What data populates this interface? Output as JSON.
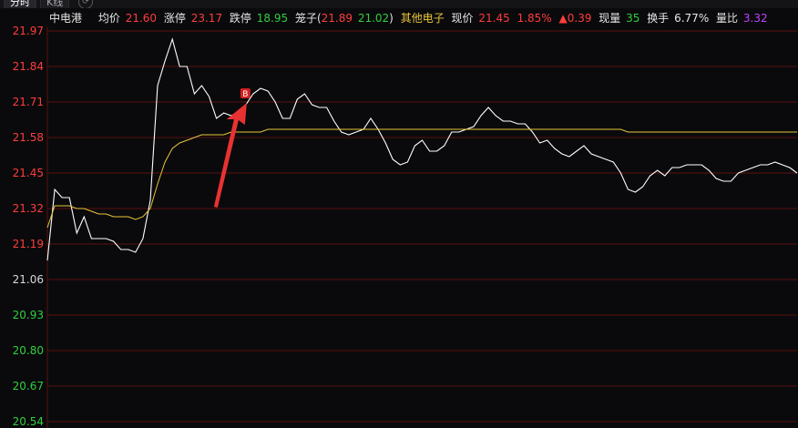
{
  "tabs": [
    {
      "label": "分时",
      "active": true
    },
    {
      "label": "K线",
      "active": false
    }
  ],
  "tab_icon": "refresh-icon",
  "info": {
    "name": "中电港",
    "avg_label": "均价",
    "avg_value": "21.60",
    "limit_up_label": "涨停",
    "limit_up_value": "23.17",
    "limit_down_label": "跌停",
    "limit_down_value": "18.95",
    "bid_label": "笼子(",
    "bid_high": "21.89",
    "bid_low": "21.02",
    "bid_close": ")",
    "sector": "其他电子",
    "price_label": "现价",
    "price_value": "21.45",
    "pct_change": "1.85%",
    "change": "▲0.39",
    "vol_label": "现量",
    "vol_value": "35",
    "turnover_label": "换手",
    "turnover_value": "6.77%",
    "ratio_label": "量比",
    "ratio_value": "3.32"
  },
  "colors": {
    "price_line": "#ffffff",
    "avg_line": "#e8c53a",
    "up": "#ff3d3d",
    "down": "#2fcf3f",
    "grid": "#5a1010",
    "background": "#0a0a0c"
  },
  "chart_data": {
    "type": "line",
    "y_ticks": [
      "21.97",
      "21.84",
      "21.71",
      "21.58",
      "21.45",
      "21.32",
      "21.19",
      "21.06",
      "20.93",
      "20.80",
      "20.67",
      "20.54"
    ],
    "ylim": [
      20.54,
      21.97
    ],
    "series": [
      {
        "role": "price",
        "values": [
          21.13,
          21.39,
          21.36,
          21.36,
          21.23,
          21.29,
          21.21,
          21.21,
          21.21,
          21.2,
          21.17,
          21.17,
          21.16,
          21.21,
          21.35,
          21.77,
          21.86,
          21.94,
          21.84,
          21.84,
          21.74,
          21.77,
          21.73,
          21.65,
          21.67,
          21.66,
          21.67,
          21.7,
          21.74,
          21.76,
          21.75,
          21.71,
          21.65,
          21.65,
          21.72,
          21.74,
          21.7,
          21.69,
          21.69,
          21.64,
          21.6,
          21.59,
          21.6,
          21.61,
          21.65,
          21.61,
          21.56,
          21.5,
          21.48,
          21.49,
          21.55,
          21.57,
          21.53,
          21.53,
          21.55,
          21.6,
          21.6,
          21.61,
          21.62,
          21.66,
          21.69,
          21.66,
          21.64,
          21.64,
          21.63,
          21.63,
          21.6,
          21.56,
          21.57,
          21.54,
          21.52,
          21.51,
          21.53,
          21.55,
          21.52,
          21.51,
          21.5,
          21.49,
          21.45,
          21.39,
          21.38,
          21.4,
          21.44,
          21.46,
          21.44,
          21.47,
          21.47,
          21.48,
          21.48,
          21.48,
          21.46,
          21.43,
          21.42,
          21.42,
          21.45,
          21.46,
          21.47,
          21.48,
          21.48,
          21.49,
          21.48,
          21.47,
          21.45
        ]
      },
      {
        "role": "average",
        "values": [
          21.25,
          21.33,
          21.33,
          21.33,
          21.32,
          21.32,
          21.31,
          21.3,
          21.3,
          21.29,
          21.29,
          21.29,
          21.28,
          21.29,
          21.32,
          21.41,
          21.49,
          21.54,
          21.56,
          21.57,
          21.58,
          21.59,
          21.59,
          21.59,
          21.59,
          21.6,
          21.6,
          21.6,
          21.6,
          21.6,
          21.61,
          21.61,
          21.61,
          21.61,
          21.61,
          21.61,
          21.61,
          21.61,
          21.61,
          21.61,
          21.61,
          21.61,
          21.61,
          21.61,
          21.61,
          21.61,
          21.61,
          21.61,
          21.61,
          21.61,
          21.61,
          21.61,
          21.61,
          21.61,
          21.61,
          21.61,
          21.61,
          21.61,
          21.61,
          21.61,
          21.61,
          21.61,
          21.61,
          21.61,
          21.61,
          21.61,
          21.61,
          21.61,
          21.61,
          21.61,
          21.61,
          21.61,
          21.61,
          21.61,
          21.61,
          21.61,
          21.61,
          21.61,
          21.61,
          21.6,
          21.6,
          21.6,
          21.6,
          21.6,
          21.6,
          21.6,
          21.6,
          21.6,
          21.6,
          21.6,
          21.6,
          21.6,
          21.6,
          21.6,
          21.6,
          21.6,
          21.6,
          21.6,
          21.6,
          21.6,
          21.6,
          21.6,
          21.6
        ]
      }
    ],
    "marker": {
      "label": "B",
      "index": 27,
      "value": 21.72
    }
  }
}
